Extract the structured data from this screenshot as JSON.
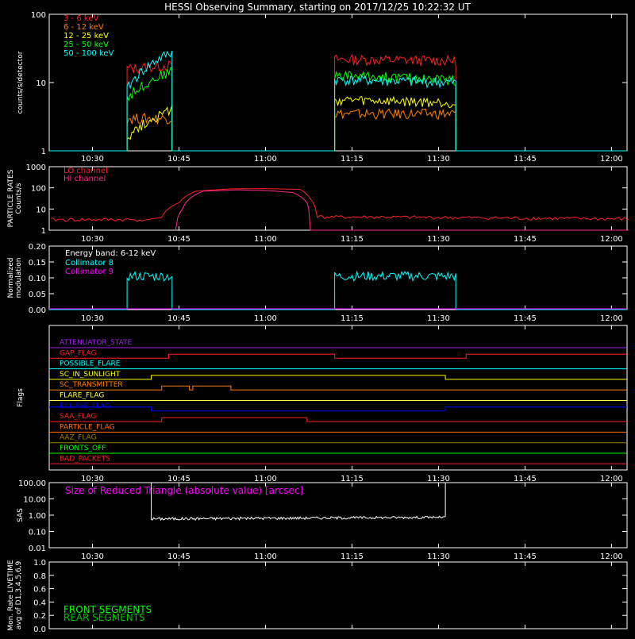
{
  "title": "HESSI Observing Summary, starting on 2017/12/25 10:22:32 UT",
  "time_ticks": [
    "10:30",
    "10:45",
    "11:00",
    "11:15",
    "11:30",
    "11:45",
    "12:00"
  ],
  "colors": {
    "red": "#ff2020",
    "orange": "#ff8000",
    "yellow": "#ffff00",
    "green": "#00ff00",
    "cyan": "#00ffff",
    "magenta": "#ff00ff",
    "blue": "#0000ff",
    "olive": "#a08000",
    "darkorange": "#ff7000",
    "white": "#ffffff",
    "darkgreen": "#00c000"
  },
  "chart_data": [
    {
      "id": "counts",
      "type": "line",
      "ylabel": "counts/s/detector",
      "yscale": "log",
      "ylim": [
        1,
        100
      ],
      "yticks": [
        "1",
        "10",
        "100"
      ],
      "series": [
        {
          "name": "3 - 6  keV",
          "color": "#ff2020",
          "segments": [
            [
              10.6,
              10.73,
              16,
              18
            ],
            [
              11.2,
              11.55,
              22,
              21
            ]
          ]
        },
        {
          "name": "6 - 12  keV",
          "color": "#ff8000",
          "segments": [
            [
              10.6,
              10.73,
              3,
              3
            ],
            [
              11.2,
              11.55,
              3.5,
              3.5
            ]
          ]
        },
        {
          "name": "12 - 25  keV",
          "color": "#ffff00",
          "segments": [
            [
              10.6,
              10.73,
              1.6,
              4
            ],
            [
              11.2,
              11.55,
              5.5,
              5
            ]
          ]
        },
        {
          "name": "25 - 50  keV",
          "color": "#00ff00",
          "segments": [
            [
              10.6,
              10.73,
              6,
              15
            ],
            [
              11.2,
              11.55,
              13,
              11
            ]
          ]
        },
        {
          "name": "50 - 100  keV",
          "color": "#00ffff",
          "segments": [
            [
              10.6,
              10.73,
              8,
              28
            ],
            [
              11.2,
              11.55,
              11,
              10
            ]
          ]
        }
      ]
    },
    {
      "id": "particle",
      "type": "line",
      "ylabel": "PARTICLE RATES\nCounts/s",
      "yscale": "log",
      "ylim": [
        1,
        1000
      ],
      "yticks": [
        "1",
        "10",
        "100",
        "1000"
      ],
      "series": [
        {
          "name": "LO channel",
          "color": "#ff2020",
          "points": [
            [
              10.38,
              3
            ],
            [
              10.65,
              3
            ],
            [
              10.7,
              4
            ],
            [
              10.75,
              20
            ],
            [
              10.8,
              70
            ],
            [
              10.9,
              90
            ],
            [
              11.0,
              92
            ],
            [
              11.1,
              85
            ],
            [
              11.13,
              30
            ],
            [
              11.15,
              4
            ],
            [
              11.3,
              4
            ],
            [
              12.05,
              3.2
            ]
          ]
        },
        {
          "name": "HI channel",
          "color": "#ff2a8a",
          "points": [
            [
              10.74,
              1
            ],
            [
              10.76,
              10
            ],
            [
              10.82,
              70
            ],
            [
              10.92,
              80
            ],
            [
              11.0,
              75
            ],
            [
              11.08,
              60
            ],
            [
              11.12,
              20
            ],
            [
              11.13,
              1
            ],
            [
              12.05,
              1
            ]
          ]
        }
      ]
    },
    {
      "id": "modulation",
      "type": "line",
      "ylabel": "Normalized\nmodulation",
      "ylim": [
        0,
        0.2
      ],
      "yticks": [
        "0.00",
        "0.05",
        "0.10",
        "0.15",
        "0.20"
      ],
      "annotation": "Energy band: 6-12 keV",
      "series": [
        {
          "name": "Collimator 8",
          "color": "#00ffff",
          "segments": [
            [
              10.6,
              10.73,
              0.105,
              0.105
            ],
            [
              11.2,
              11.55,
              0.105,
              0.105
            ]
          ]
        },
        {
          "name": "Collimator 9",
          "color": "#ff00ff",
          "level": 0.0
        }
      ]
    },
    {
      "id": "flags",
      "type": "line",
      "ylabel": "Flags",
      "series": [
        {
          "name": "ATTENUATOR_STATE",
          "color": "#a020f0",
          "changes": []
        },
        {
          "name": "GAP_FLAG",
          "color": "#ff2020",
          "changes": [
            [
              10.72,
              1
            ],
            [
              11.2,
              0
            ],
            [
              11.58,
              1
            ]
          ]
        },
        {
          "name": "POSSIBLE_FLARE",
          "color": "#00ffff",
          "changes": []
        },
        {
          "name": "SC_IN_SUNLIGHT",
          "color": "#ffff00",
          "changes": [
            [
              10.67,
              1
            ],
            [
              11.52,
              0
            ]
          ]
        },
        {
          "name": "SC_TRANSMITTER",
          "color": "#ff8000",
          "changes": [
            [
              10.7,
              1
            ],
            [
              10.78,
              0
            ],
            [
              10.79,
              1
            ],
            [
              10.9,
              0
            ]
          ]
        },
        {
          "name": "FLARE_FLAG",
          "color": "#ffff40",
          "changes": []
        },
        {
          "name": "ECLIPSE_FLAG",
          "color": "#0000ff",
          "changes": [
            [
              10.67,
              0
            ],
            [
              11.52,
              1
            ]
          ]
        },
        {
          "name": "SAA_FLAG",
          "color": "#ff2020",
          "changes": [
            [
              10.7,
              1
            ],
            [
              11.12,
              0
            ]
          ]
        },
        {
          "name": "PARTICLE_FLAG",
          "color": "#ff7000",
          "changes": []
        },
        {
          "name": "AAZ_FLAG",
          "color": "#a08000",
          "changes": []
        },
        {
          "name": "FRONTS_OFF",
          "color": "#00ff00",
          "changes": []
        },
        {
          "name": "BAD_PACKETS",
          "color": "#ff2020",
          "changes": []
        }
      ]
    },
    {
      "id": "sas",
      "type": "line",
      "ylabel": "SAS",
      "yscale": "log",
      "ylim": [
        0.01,
        100
      ],
      "yticks": [
        "0.01",
        "0.10",
        "1.00",
        "10.00",
        "100.00"
      ],
      "annotation": "Size of Reduced Triangle (absolute value) [arcsec]",
      "series": [
        {
          "name": "SAS triangle",
          "color": "#ffffff",
          "segments": [
            [
              10.67,
              11.52,
              0.6,
              0.75
            ]
          ]
        }
      ]
    },
    {
      "id": "livetime",
      "type": "line",
      "ylabel": "Mon. Rate LIVETIME\navg of D1,3,4,5,6,9",
      "ylim": [
        0,
        1
      ],
      "yticks": [
        "0.0",
        "0.2",
        "0.4",
        "0.6",
        "0.8",
        "1.0"
      ],
      "series": [
        {
          "name": "FRONT SEGMENTS",
          "color": "#00ff00"
        },
        {
          "name": "REAR SEGMENTS",
          "color": "#00c000"
        }
      ]
    }
  ]
}
